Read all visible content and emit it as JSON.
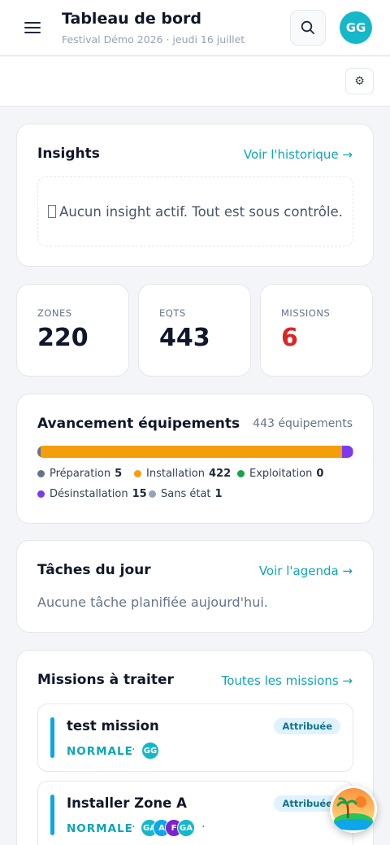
{
  "header": {
    "title": "Tableau de bord",
    "subtitle": "Festival Démo 2026 · jeudi 16 juillet",
    "avatar": "GG"
  },
  "insights": {
    "title": "Insights",
    "link": "Voir l'historique →",
    "empty": "Aucun insight actif. Tout est sous contrôle."
  },
  "stats": [
    {
      "label": "ZONES",
      "value": "220"
    },
    {
      "label": "EQTS",
      "value": "443"
    },
    {
      "label": "MISSIONS",
      "value": "6"
    }
  ],
  "progress": {
    "title": "Avancement équipements",
    "total": "443 équipements",
    "segments": [
      {
        "label": "Préparation",
        "count": "5",
        "value": 5,
        "color": "#64748b"
      },
      {
        "label": "Installation",
        "count": "422",
        "value": 422,
        "color": "#f59e0b"
      },
      {
        "label": "Exploitation",
        "count": "0",
        "value": 0,
        "color": "#16a34a"
      },
      {
        "label": "Désinstallation",
        "count": "15",
        "value": 15,
        "color": "#7c3aed"
      },
      {
        "label": "Sans état",
        "count": "1",
        "value": 1,
        "color": "#94a3b8"
      }
    ]
  },
  "tasks": {
    "title": "Tâches du jour",
    "link": "Voir l'agenda →",
    "empty": "Aucune tâche planifiée aujourd'hui."
  },
  "missions": {
    "title": "Missions à traiter",
    "link": "Toutes les missions →",
    "items": [
      {
        "title": "test mission",
        "priority": "NORMALE",
        "status": "Attribuée",
        "avatars": [
          "GG"
        ]
      },
      {
        "title": "Installer Zone A",
        "priority": "NORMALE",
        "status": "Attribuée",
        "avatars": [
          "GA",
          "A",
          "F",
          "GA"
        ]
      }
    ]
  },
  "colors": {
    "accent": "#0ea5b7",
    "alert": "#dc2626"
  }
}
